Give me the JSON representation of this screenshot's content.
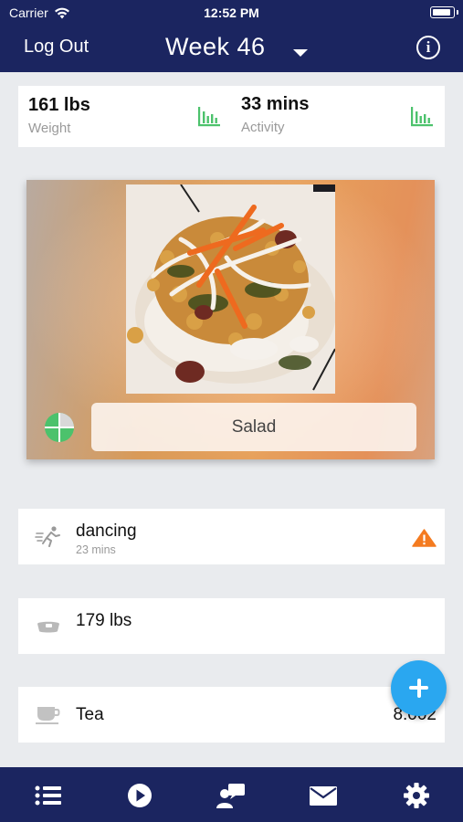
{
  "status_bar": {
    "carrier": "Carrier",
    "time": "12:52 PM"
  },
  "nav": {
    "logout_label": "Log Out",
    "week_label": "Week",
    "week_number": "46"
  },
  "summary": {
    "weight": {
      "value": "161 lbs",
      "label": "Weight"
    },
    "activity": {
      "value": "33 mins",
      "label": "Activity"
    }
  },
  "meal": {
    "name": "Salad"
  },
  "entries": [
    {
      "title": "dancing",
      "subtitle": "23 mins",
      "icon": "running-person-icon",
      "alert_icon": "warning-icon"
    },
    {
      "title": "179 lbs",
      "icon": "scale-icon"
    },
    {
      "title": "Tea",
      "value": "8.002",
      "icon": "cup-icon"
    }
  ],
  "tabs": [
    "list-icon",
    "play-icon",
    "coach-icon",
    "mail-icon",
    "gear-icon"
  ],
  "colors": {
    "navy": "#1b2560",
    "accent_green": "#4cc26c",
    "fab_blue": "#2aa7f0",
    "warning_orange": "#f47b20"
  }
}
